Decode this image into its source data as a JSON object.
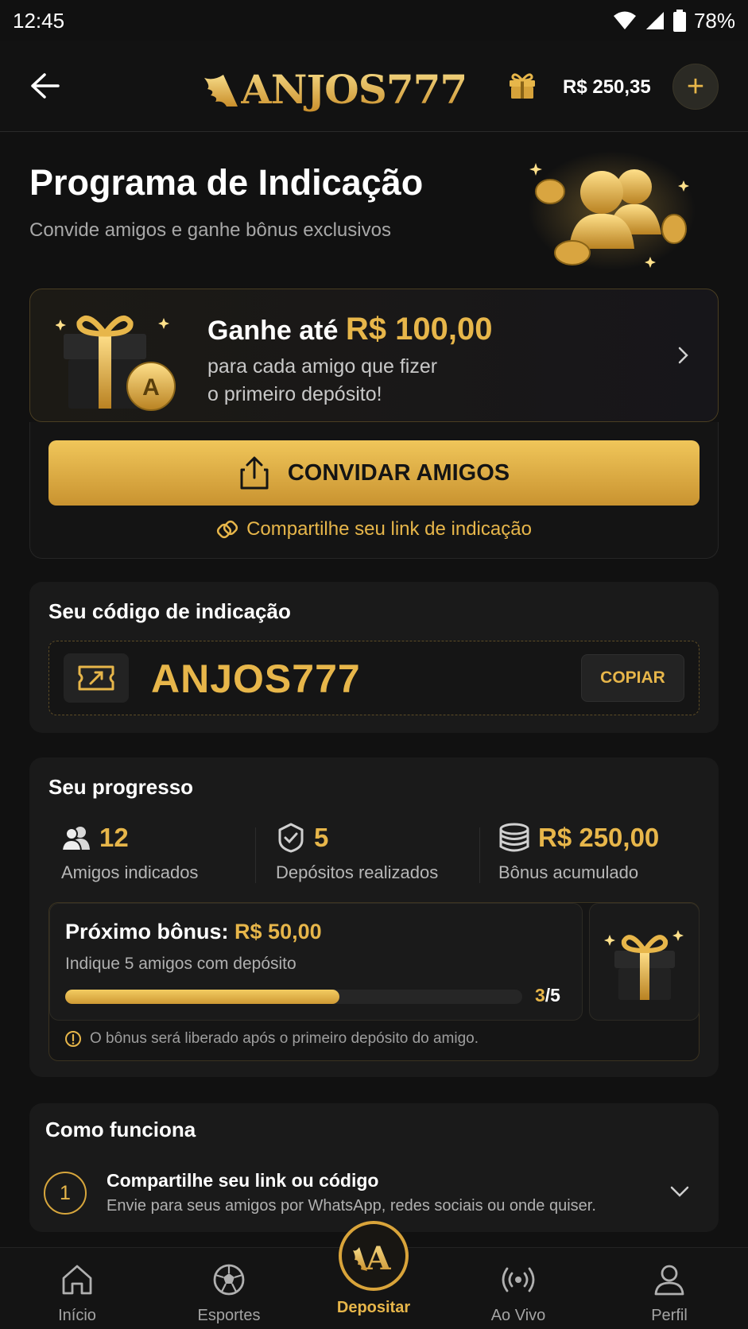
{
  "status_bar": {
    "time": "12:45",
    "battery": "78%"
  },
  "header": {
    "logo": "ANJOS777",
    "balance": "R$ 250,35",
    "add_label": "+"
  },
  "hero": {
    "title": "Programa de Indicação",
    "subtitle": "Convide amigos e ganhe bônus exclusivos"
  },
  "promo": {
    "prefix": "Ganhe até",
    "amount": "R$ 100,00",
    "line2": "para cada amigo que fizer",
    "line3": "o primeiro depósito!",
    "coin_letter": "A"
  },
  "invite": {
    "button_label": "CONVIDAR AMIGOS",
    "share_link_label": "Compartilhe seu link de indicação"
  },
  "code": {
    "title": "Seu código de indicação",
    "value": "ANJOS777",
    "copy_label": "COPIAR"
  },
  "progress": {
    "title": "Seu progresso",
    "stats": [
      {
        "value": "12",
        "label": "Amigos indicados"
      },
      {
        "value": "5",
        "label": "Depósitos realizados"
      },
      {
        "value": "R$ 250,00",
        "label": "Bônus acumulado"
      }
    ],
    "next_bonus": {
      "label": "Próximo bônus:",
      "amount": "R$ 50,00",
      "subtitle": "Indique 5 amigos com depósito",
      "current": "3",
      "total": "/5",
      "fraction": 0.6
    },
    "info": "O bônus será liberado após o primeiro depósito do amigo."
  },
  "how": {
    "title": "Como funciona",
    "steps": [
      {
        "number": "1",
        "title": "Compartilhe seu link ou código",
        "desc": "Envie para seus amigos por WhatsApp, redes sociais ou onde quiser."
      }
    ]
  },
  "nav": {
    "items": [
      {
        "label": "Início",
        "icon": "home-icon"
      },
      {
        "label": "Esportes",
        "icon": "soccer-ball-icon"
      },
      {
        "label": "Depositar",
        "icon": "anjos-logo-icon",
        "letter": "A"
      },
      {
        "label": "Ao Vivo",
        "icon": "live-broadcast-icon"
      },
      {
        "label": "Perfil",
        "icon": "user-icon"
      }
    ]
  },
  "colors": {
    "accent": "#e7b64a",
    "background": "#111111",
    "card": "#1a1a1a"
  }
}
